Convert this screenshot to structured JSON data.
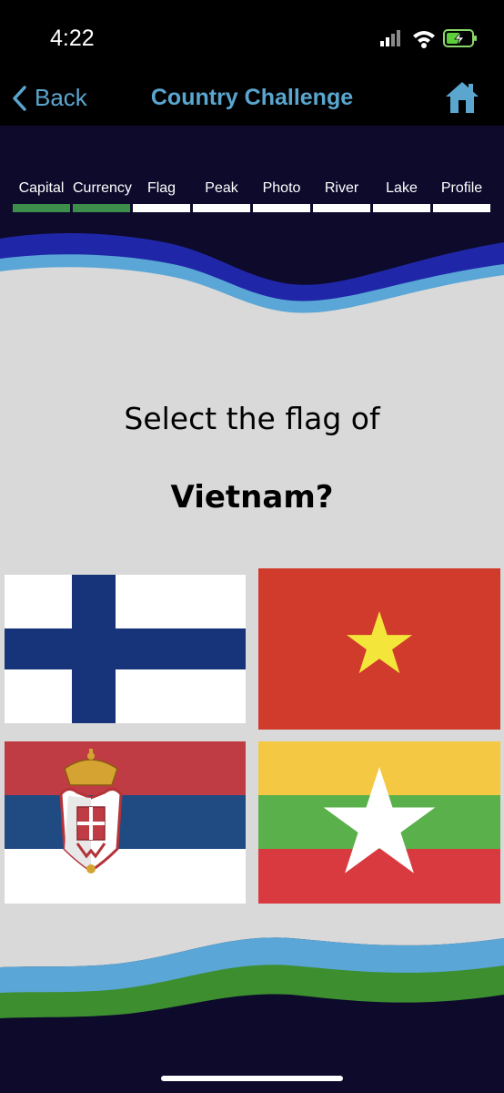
{
  "status_bar": {
    "time": "4:22"
  },
  "nav": {
    "back_label": "Back",
    "title": "Country Challenge",
    "accent_color": "#5aa6cf"
  },
  "progress": {
    "items": [
      {
        "label": "Capital",
        "completed": true
      },
      {
        "label": "Currency",
        "completed": true
      },
      {
        "label": "Flag",
        "completed": false
      },
      {
        "label": "Peak",
        "completed": false
      },
      {
        "label": "Photo",
        "completed": false
      },
      {
        "label": "River",
        "completed": false
      },
      {
        "label": "Lake",
        "completed": false
      },
      {
        "label": "Profile",
        "completed": false
      }
    ]
  },
  "question": {
    "prompt": "Select the flag of",
    "country": "Vietnam?"
  },
  "options": [
    {
      "flag": "finland-flag"
    },
    {
      "flag": "vietnam-flag"
    },
    {
      "flag": "serbia-flag"
    },
    {
      "flag": "myanmar-flag"
    }
  ],
  "colors": {
    "background": "#0d0a2c",
    "panel": "#d9d9d9",
    "wave_top_dark": "#1f27a8",
    "wave_light": "#5aa6d6",
    "wave_bottom_green": "#3d8e2f",
    "progress_done": "#3d8e4a"
  }
}
